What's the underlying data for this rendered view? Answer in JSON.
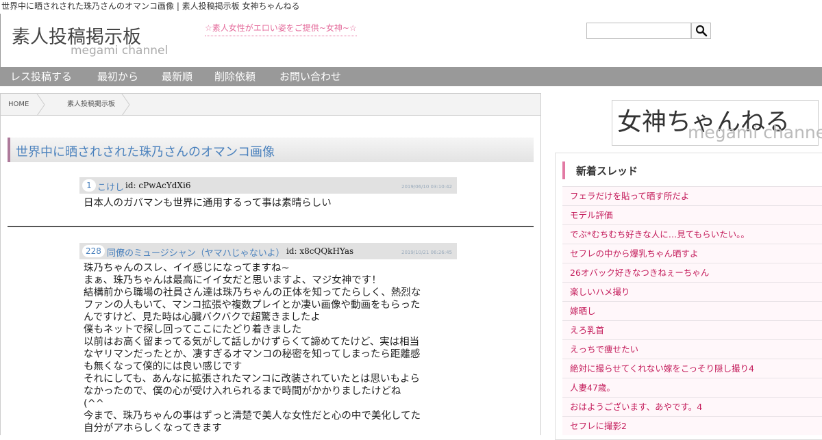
{
  "browser": {
    "title": "世界中に晒されされた珠乃さんのオマンコ画像 | 素人投稿掲示板 女神ちゃんねる"
  },
  "header": {
    "logo_main": "素人投稿掲示板",
    "logo_sub": "megami channel",
    "tagline": "☆素人女性がエロい姿をご提供~女神~☆",
    "search": {
      "value": "",
      "placeholder": "",
      "icon": "search-icon"
    }
  },
  "nav": {
    "items": [
      {
        "label": "レス投稿する"
      },
      {
        "label": "最初から"
      },
      {
        "label": "最新順"
      },
      {
        "label": "削除依頼"
      },
      {
        "label": "お問い合わせ"
      }
    ]
  },
  "breadcrumb": {
    "items": [
      {
        "label": "HOME"
      },
      {
        "label": "素人投稿掲示板"
      }
    ]
  },
  "thread": {
    "title": "世界中に晒されされた珠乃さんのオマンコ画像",
    "posts": [
      {
        "number": "1",
        "name": "こけし",
        "id": "id: cPwAcYdXi6",
        "date": "2019/06/10 03:10:42",
        "lines": [
          "日本人のガバマンも世界に通用するって事は素晴らしい"
        ]
      },
      {
        "number": "228",
        "name": "同僚のミュージシャン（ヤマハじゃないよ）",
        "id": "id: x8cQQkHYas",
        "date": "2019/10/21 06:26:45",
        "lines": [
          "珠乃ちゃんのスレ、イイ感じになってますね~",
          "まぁ、珠乃ちゃんは最高にイイ女だと思いますよ、マジ女神です！",
          "結構前から職場の社員さん達は珠乃ちゃんの正体を知ってたらしく、熱烈な",
          "ファンの人もいて、マンコ拡張や複数プレイとか凄い画像や動画をもらった",
          "んですけど、見た時は心臓バクバクで超驚きましたよ",
          "僕もネットで探し回ってここにたどり着きました",
          "以前はお高く留まってる気がして話しかけずらくて諦めてたけど、実は相当",
          "なヤリマンだったとか、凄すぎるオマンコの秘密を知ってしまったら距離感",
          "も無くなって僕的には良い感じです",
          "それにしても、あんなに拡張されたマンコに改装されていたとは思いもよら",
          "なかったので、僕の心が受け入れられるまで時間がかかりましたけどね",
          "(^^",
          "今まで、珠乃ちゃんの事はずっと清楚で美人な女性だと心の中で美化してた",
          "自分がアホらしくなってきます"
        ]
      }
    ]
  },
  "sidebar": {
    "logo_main": "女神ちゃんねる",
    "logo_sub": "megami channel",
    "heading": "新着スレッド",
    "items": [
      {
        "label": "フェラだけを貼って晒す所だよ"
      },
      {
        "label": "モデル評価"
      },
      {
        "label": "でぶ*むちむち好きな人に…見てもらいたい。。"
      },
      {
        "label": "セフレの中から爆乳ちゃん晒すよ"
      },
      {
        "label": "26オバック好きなつきねぇーちゃん"
      },
      {
        "label": "楽しいハメ撮り"
      },
      {
        "label": "嫁晒し"
      },
      {
        "label": "えろ乳首"
      },
      {
        "label": "えっちで痩せたい"
      },
      {
        "label": "絶対に撮らせてくれない嫁をこっそり隠し撮り4"
      },
      {
        "label": "人妻47歳。"
      },
      {
        "label": "おはようございます、あやです。4"
      },
      {
        "label": "セフレに撮影2"
      }
    ]
  },
  "colors": {
    "nav_bg": "#999999",
    "link_blue": "#4a81bd",
    "accent_pink": "#e46b9b",
    "sidebar_link": "#c41c5b"
  }
}
